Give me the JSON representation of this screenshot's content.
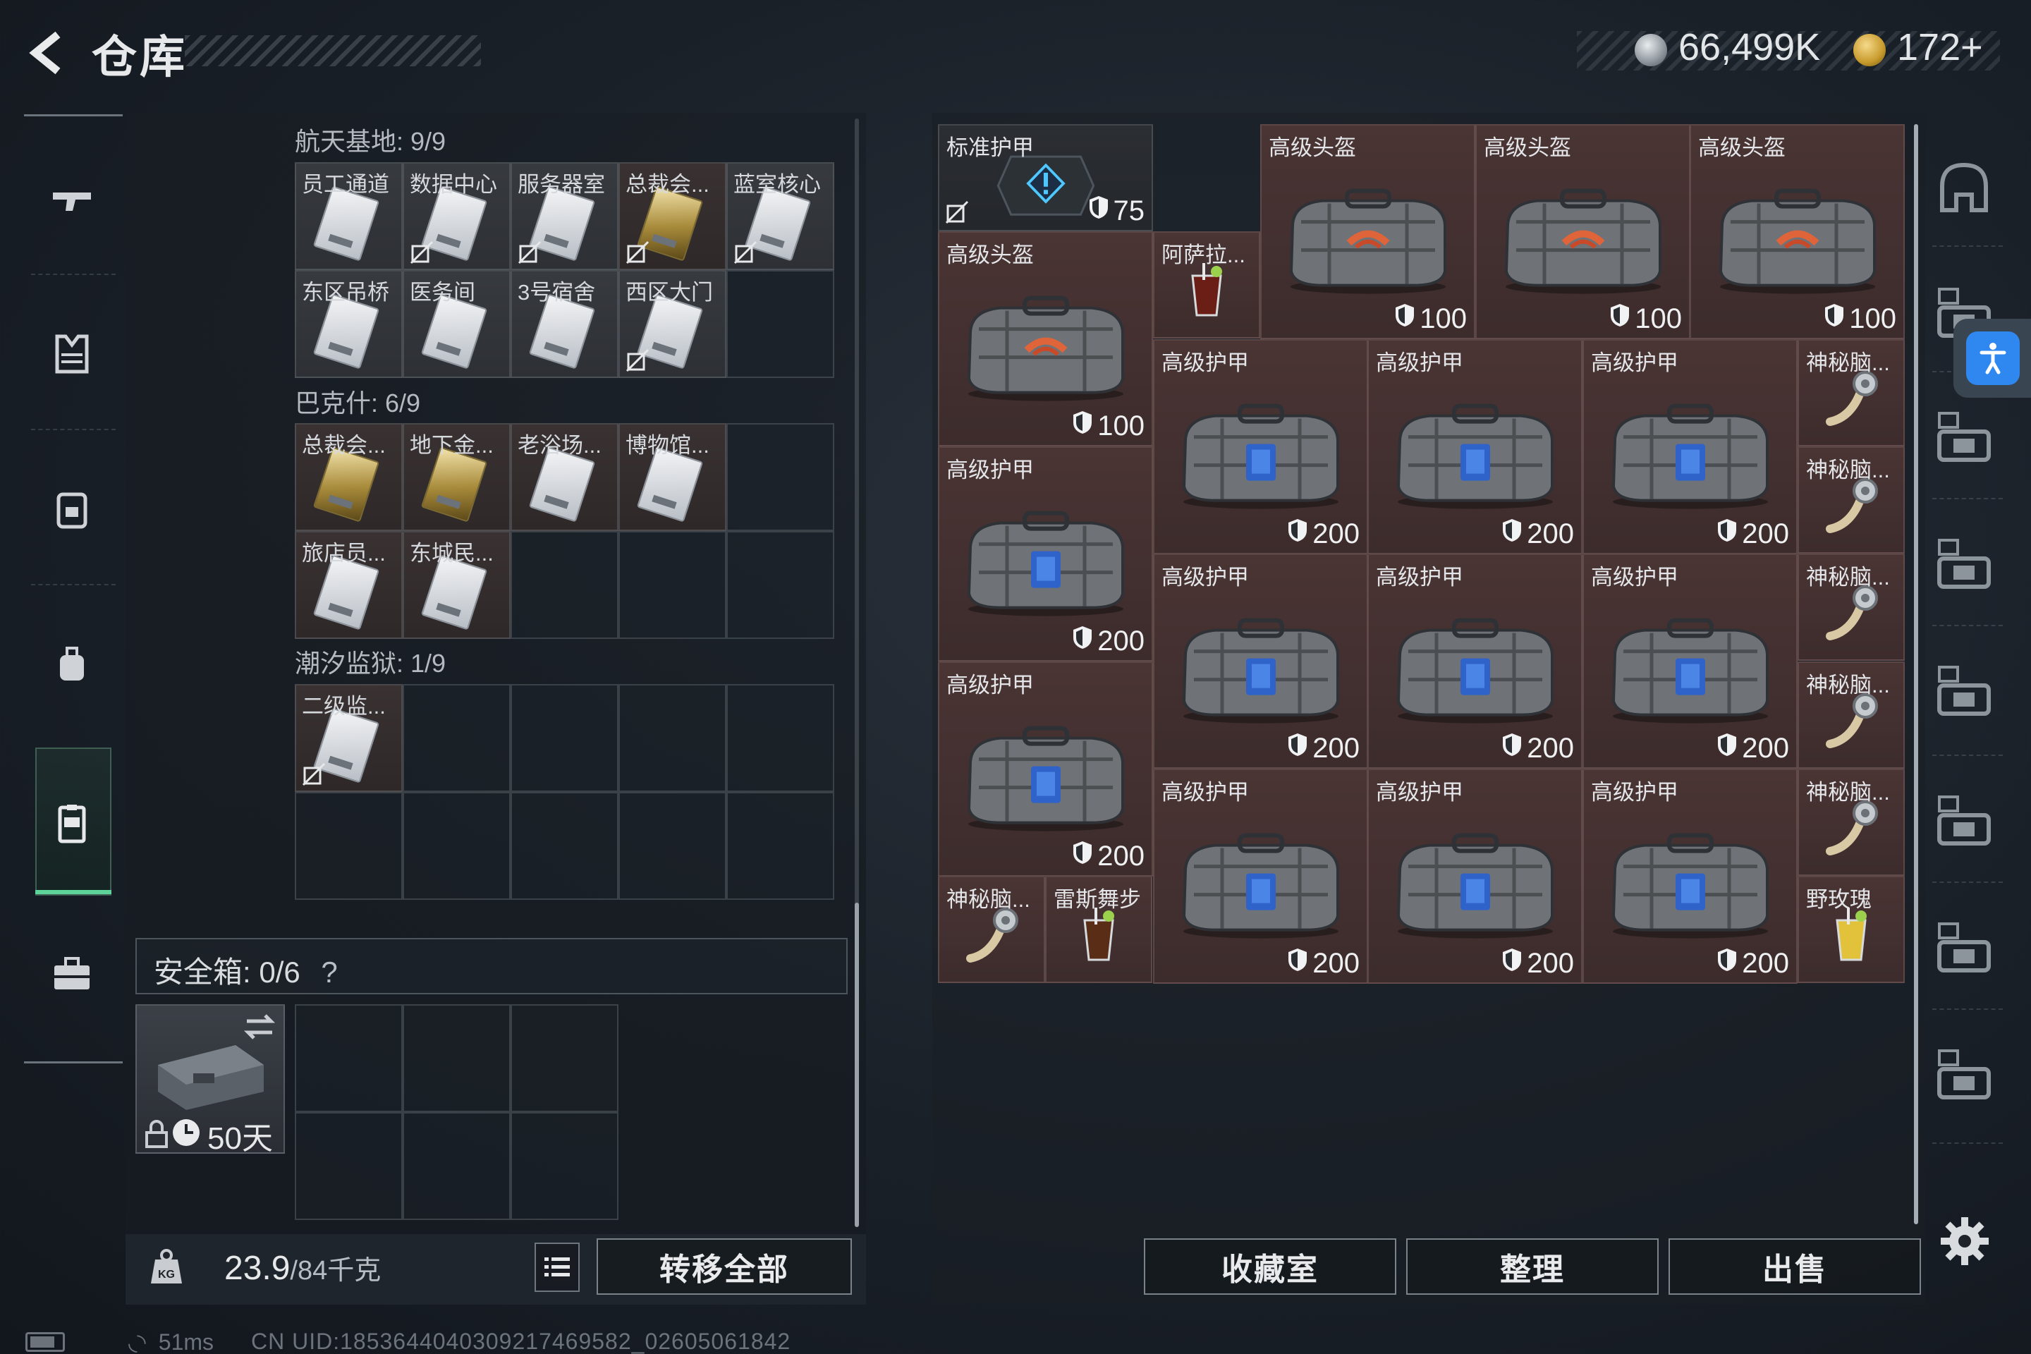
{
  "header": {
    "title": "仓库",
    "currency": [
      {
        "icon": "silver-coin-icon",
        "value": "66,499K"
      },
      {
        "icon": "gold-coin-icon",
        "value": "172+"
      }
    ]
  },
  "categories": [
    {
      "name": "weapon-icon"
    },
    {
      "name": "armor-vest-icon"
    },
    {
      "name": "backpack-icon"
    },
    {
      "name": "bag-icon"
    },
    {
      "name": "keycard-icon",
      "active": true
    },
    {
      "name": "briefcase-icon"
    }
  ],
  "key_sections": [
    {
      "title": "航天基地: 9/9",
      "cells": [
        {
          "label": "员工通道",
          "card": "white",
          "bound": false
        },
        {
          "label": "数据中心",
          "card": "white",
          "bound": true
        },
        {
          "label": "服务器室",
          "card": "white",
          "bound": true
        },
        {
          "label": "总裁会...",
          "card": "gold",
          "bound": true
        },
        {
          "label": "蓝室核心",
          "card": "white",
          "bound": true
        },
        {
          "label": "东区吊桥",
          "card": "white",
          "bound": false
        },
        {
          "label": "医务间",
          "card": "white",
          "bound": false
        },
        {
          "label": "3号宿舍",
          "card": "white",
          "bound": false
        },
        {
          "label": "西区大门",
          "card": "white",
          "bound": true
        },
        null
      ]
    },
    {
      "title": "巴克什: 6/9",
      "cells": [
        {
          "label": "总裁会...",
          "card": "gold",
          "bound": false
        },
        {
          "label": "地下金...",
          "card": "gold",
          "bound": false
        },
        {
          "label": "老浴场...",
          "card": "white",
          "bound": false
        },
        {
          "label": "博物馆...",
          "card": "white",
          "bound": false
        },
        null,
        {
          "label": "旅店员...",
          "card": "white",
          "bound": false
        },
        {
          "label": "东城民...",
          "card": "white",
          "bound": false
        },
        null,
        null,
        null
      ]
    },
    {
      "title": "潮汐监狱: 1/9",
      "cells": [
        {
          "label": "二级监...",
          "card": "white",
          "bound": true
        },
        null,
        null,
        null,
        null,
        null,
        null,
        null,
        null,
        null
      ]
    }
  ],
  "safe_box": {
    "title": "安全箱: 0/6",
    "help": "?",
    "days": "50天"
  },
  "footer_left": {
    "weight_current": "23.9",
    "weight_max": "/84千克",
    "transfer_label": "转移全部"
  },
  "stash_items": [
    {
      "label": "标准护甲",
      "type": "box",
      "durability": "75",
      "dark": true
    },
    {
      "label": "高级头盔",
      "type": "helmet",
      "durability": "100"
    },
    {
      "label": "高级头盔",
      "type": "helmet",
      "durability": "100"
    },
    {
      "label": "高级头盔",
      "type": "helmet",
      "durability": "100"
    },
    {
      "label": "高级头盔",
      "type": "helmet",
      "durability": "100"
    },
    {
      "label": "阿萨拉...",
      "type": "drink-red"
    },
    {
      "label": "高级护甲",
      "type": "armor",
      "durability": "200"
    },
    {
      "label": "高级护甲",
      "type": "armor",
      "durability": "200"
    },
    {
      "label": "高级护甲",
      "type": "armor",
      "durability": "200"
    },
    {
      "label": "神秘脑...",
      "type": "brain"
    },
    {
      "label": "神秘脑...",
      "type": "brain"
    },
    {
      "label": "高级护甲",
      "type": "armor",
      "durability": "200"
    },
    {
      "label": "高级护甲",
      "type": "armor",
      "durability": "200"
    },
    {
      "label": "高级护甲",
      "type": "armor",
      "durability": "200"
    },
    {
      "label": "高级护甲",
      "type": "armor",
      "durability": "200"
    },
    {
      "label": "神秘脑...",
      "type": "brain"
    },
    {
      "label": "神秘脑...",
      "type": "brain"
    },
    {
      "label": "高级护甲",
      "type": "armor",
      "durability": "200"
    },
    {
      "label": "高级护甲",
      "type": "armor",
      "durability": "200"
    },
    {
      "label": "高级护甲",
      "type": "armor",
      "durability": "200"
    },
    {
      "label": "高级护甲",
      "type": "armor",
      "durability": "200"
    },
    {
      "label": "神秘脑...",
      "type": "brain"
    },
    {
      "label": "神秘脑...",
      "type": "brain"
    },
    {
      "label": "雷斯舞步",
      "type": "drink-brown"
    },
    {
      "label": "野玫瑰",
      "type": "drink-yellow"
    }
  ],
  "side_icons": [
    "helmet-slot-icon",
    "tier4-helmet-filter-icon",
    "tier4-armor-filter-icon",
    "tier4-medkit-add-icon",
    "tier3-armor-filter-icon",
    "tier4-rig-filter-icon",
    "tier5-helmet-filter-icon",
    "tier3-helmet-filter-icon"
  ],
  "footer_right": {
    "buttons": [
      "收藏室",
      "整理",
      "出售"
    ]
  },
  "status": {
    "ping": "51ms",
    "uid": "CN UID:1853644040309217469582_02605061842"
  },
  "colors": {
    "accent_green": "#5dd39a",
    "accessibility_blue": "#2f87f0",
    "tile_red": "#4a3434"
  }
}
